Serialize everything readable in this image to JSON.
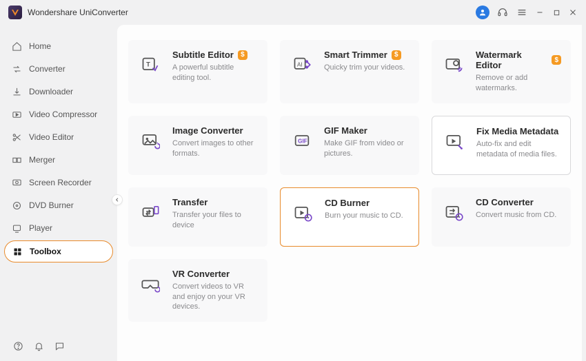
{
  "app": {
    "title": "Wondershare UniConverter"
  },
  "titlebar": {
    "avatar": "user",
    "icons": [
      "headset",
      "menu"
    ],
    "window": [
      "minimize",
      "maximize",
      "close"
    ]
  },
  "sidebar": {
    "items": [
      {
        "key": "home",
        "label": "Home"
      },
      {
        "key": "converter",
        "label": "Converter"
      },
      {
        "key": "downloader",
        "label": "Downloader"
      },
      {
        "key": "video-compressor",
        "label": "Video Compressor"
      },
      {
        "key": "video-editor",
        "label": "Video Editor"
      },
      {
        "key": "merger",
        "label": "Merger"
      },
      {
        "key": "screen-recorder",
        "label": "Screen Recorder"
      },
      {
        "key": "dvd-burner",
        "label": "DVD Burner"
      },
      {
        "key": "player",
        "label": "Player"
      },
      {
        "key": "toolbox",
        "label": "Toolbox",
        "active": true
      }
    ],
    "bottom": [
      "help",
      "notifications",
      "feedback"
    ]
  },
  "tools": [
    {
      "key": "subtitle-editor",
      "title": "Subtitle Editor",
      "desc": "A powerful subtitle editing tool.",
      "paid": true
    },
    {
      "key": "smart-trimmer",
      "title": "Smart Trimmer",
      "desc": "Quicky trim your videos.",
      "paid": true
    },
    {
      "key": "watermark-editor",
      "title": "Watermark Editor",
      "desc": "Remove or add watermarks.",
      "paid": true
    },
    {
      "key": "image-converter",
      "title": "Image Converter",
      "desc": "Convert images to other formats.",
      "paid": false
    },
    {
      "key": "gif-maker",
      "title": "GIF Maker",
      "desc": "Make GIF from video or pictures.",
      "paid": false
    },
    {
      "key": "fix-media-metadata",
      "title": "Fix Media Metadata",
      "desc": "Auto-fix and edit metadata of media files.",
      "paid": false,
      "variant": "outlined-gray"
    },
    {
      "key": "transfer",
      "title": "Transfer",
      "desc": "Transfer your files to device",
      "paid": false
    },
    {
      "key": "cd-burner",
      "title": "CD Burner",
      "desc": "Burn your music to CD.",
      "paid": false,
      "variant": "outlined-orange"
    },
    {
      "key": "cd-converter",
      "title": "CD Converter",
      "desc": "Convert music from CD.",
      "paid": false
    },
    {
      "key": "vr-converter",
      "title": "VR Converter",
      "desc": "Convert videos to VR and enjoy on your VR devices.",
      "paid": false
    }
  ],
  "badge_symbol": "$",
  "colors": {
    "accent": "#e88a2a",
    "badge": "#f59a23",
    "avatar": "#2a7ae2"
  }
}
